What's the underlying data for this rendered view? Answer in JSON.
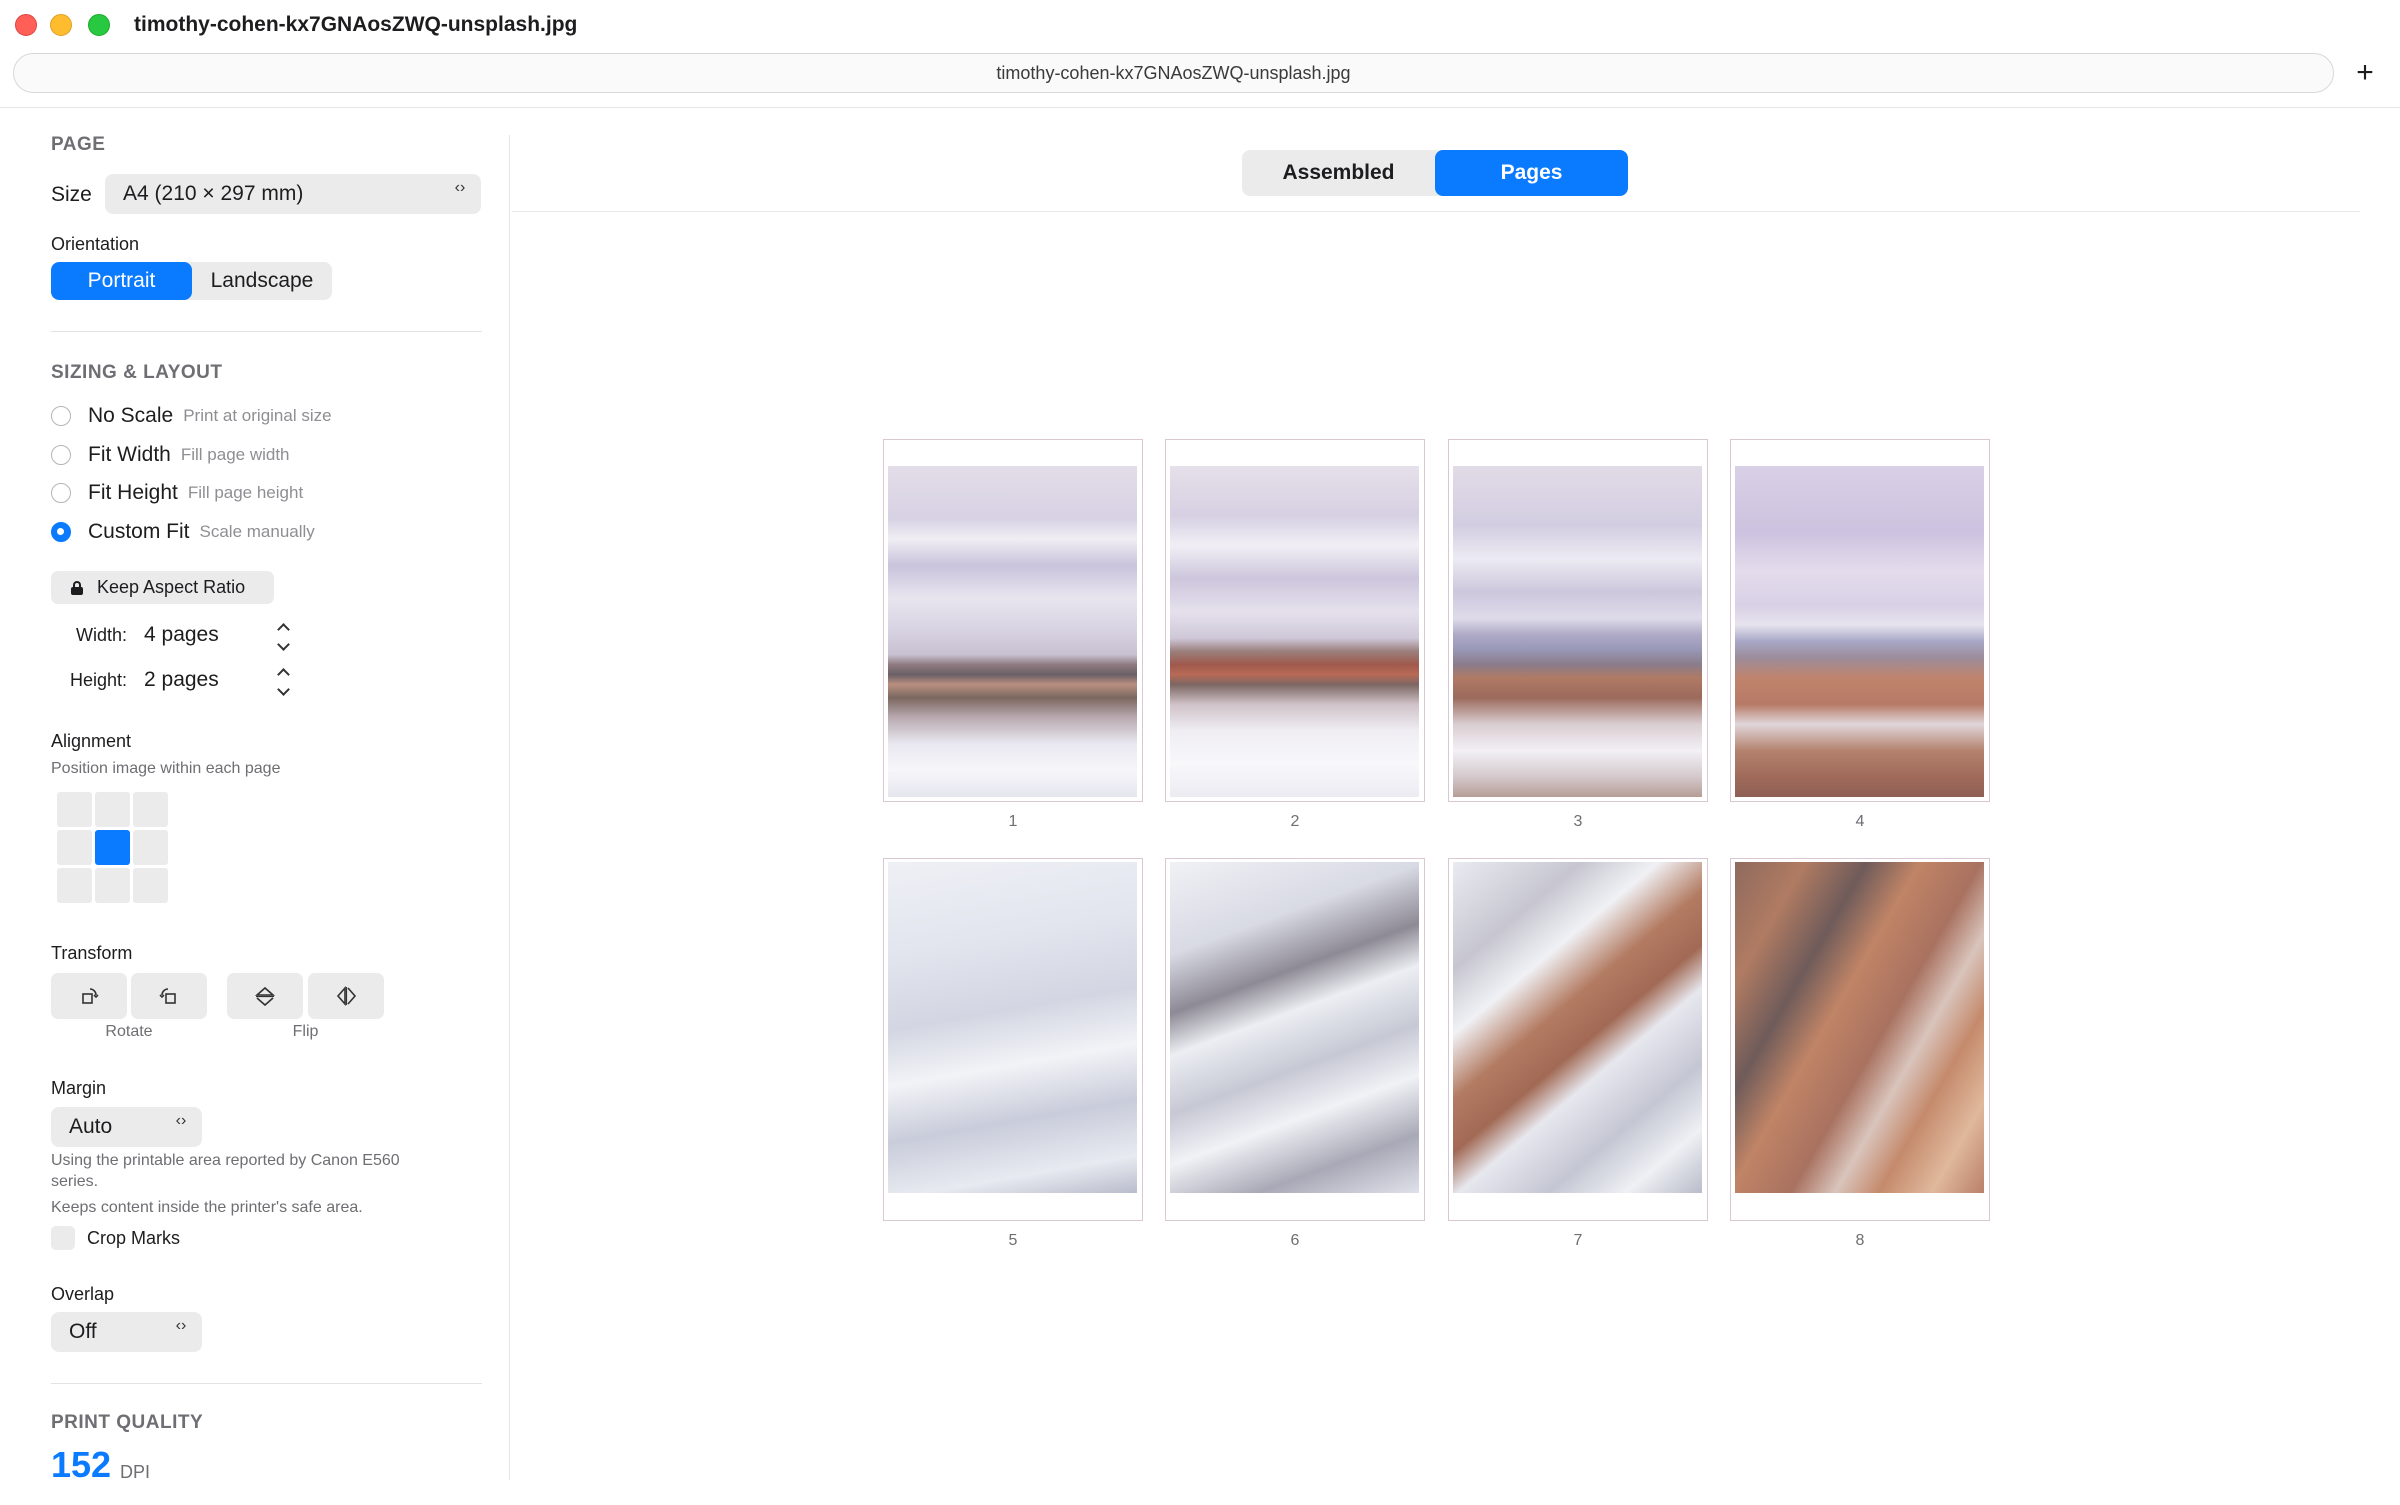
{
  "window": {
    "title": "timothy-cohen-kx7GNAosZWQ-unsplash.jpg",
    "address": "timothy-cohen-kx7GNAosZWQ-unsplash.jpg",
    "new_tab_label": "+"
  },
  "page_section": {
    "title": "PAGE",
    "size_label": "Size",
    "size_value": "A4 (210 × 297 mm)",
    "orientation_label": "Orientation",
    "orientation_options": [
      "Portrait",
      "Landscape"
    ],
    "orientation_selected": "Portrait"
  },
  "sizing": {
    "title": "SIZING & LAYOUT",
    "options": [
      {
        "label": "No Scale",
        "hint": "Print at original size",
        "selected": false
      },
      {
        "label": "Fit Width",
        "hint": "Fill page width",
        "selected": false
      },
      {
        "label": "Fit Height",
        "hint": "Fill page height",
        "selected": false
      },
      {
        "label": "Custom Fit",
        "hint": "Scale manually",
        "selected": true
      }
    ],
    "keep_aspect_label": "Keep Aspect Ratio",
    "width_label": "Width:",
    "width_value": "4 pages",
    "height_label": "Height:",
    "height_value": "2 pages"
  },
  "alignment": {
    "title": "Alignment",
    "subtitle": "Position image within each page",
    "selected_cell": 4
  },
  "transform": {
    "title": "Transform",
    "rotate_label": "Rotate",
    "flip_label": "Flip"
  },
  "margin": {
    "title": "Margin",
    "value": "Auto",
    "note1": "Using the printable area reported by Canon E560 series.",
    "note2": "Keeps content inside the printer's safe area.",
    "crop_marks_label": "Crop Marks",
    "crop_marks_checked": false
  },
  "overlap": {
    "title": "Overlap",
    "value": "Off"
  },
  "quality": {
    "title": "PRINT QUALITY",
    "value": "152",
    "unit": "DPI"
  },
  "view": {
    "tabs": [
      "Assembled",
      "Pages"
    ],
    "selected": "Pages"
  },
  "pages": [
    {
      "number": "1"
    },
    {
      "number": "2"
    },
    {
      "number": "3"
    },
    {
      "number": "4"
    },
    {
      "number": "5"
    },
    {
      "number": "6"
    },
    {
      "number": "7"
    },
    {
      "number": "8"
    }
  ],
  "colors": {
    "accent": "#0a7aff",
    "control_bg": "#ebebec"
  }
}
